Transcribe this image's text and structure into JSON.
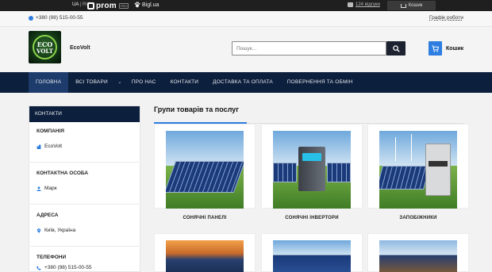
{
  "topbar": {
    "lang_active": "UA",
    "lang_other": "RU",
    "prom_name": "prom",
    "prom_badge": "PRO",
    "bigl_name": "Bigl.ua",
    "reviews_link": "124 відгуки",
    "cart_label": "Кошик"
  },
  "contact_bar": {
    "phone": "+380 (98) 515-00-55",
    "schedule_link": "Графік роботи"
  },
  "header": {
    "logo_text_top": "ECO",
    "logo_text_bottom": "VOLT",
    "brand": "EcoVolt",
    "search_placeholder": "Пошук...",
    "cart_label": "Кошик"
  },
  "nav": {
    "items": [
      {
        "label": "ГОЛОВНА",
        "active": true
      },
      {
        "label": "ВСІ ТОВАРИ",
        "active": false
      },
      {
        "label": "ПРО НАС",
        "active": false
      },
      {
        "label": "КОНТАКТИ",
        "active": false
      },
      {
        "label": "ДОСТАВКА ТА ОПЛАТА",
        "active": false
      },
      {
        "label": "ПОВЕРНЕННЯ ТА ОБМІН",
        "active": false
      }
    ]
  },
  "sidebar": {
    "heading": "КОНТАКТИ",
    "company_title": "КОМПАНІЯ",
    "company_value": "EcoVolt",
    "person_title": "КОНТАКТНА ОСОБА",
    "person_value": "Марк",
    "address_title": "АДРЕСА",
    "address_value": "Київ, Україна",
    "phones_title": "ТЕЛЕФОНИ",
    "phones_value": "+380 (98) 515-00-55"
  },
  "main": {
    "title": "Групи товарів та послуг",
    "groups": [
      {
        "label": "СОНЯЧНІ ПАНЕЛІ"
      },
      {
        "label": "СОНЯЧНІ ІНВЕРТОРИ"
      },
      {
        "label": "ЗАПОБІЖНИКИ"
      }
    ]
  },
  "colors": {
    "nav_bg": "#0c1f3d",
    "nav_active": "#1d3c6c",
    "accent": "#2d7ee0",
    "topbar_bg": "#1f1f1f"
  }
}
